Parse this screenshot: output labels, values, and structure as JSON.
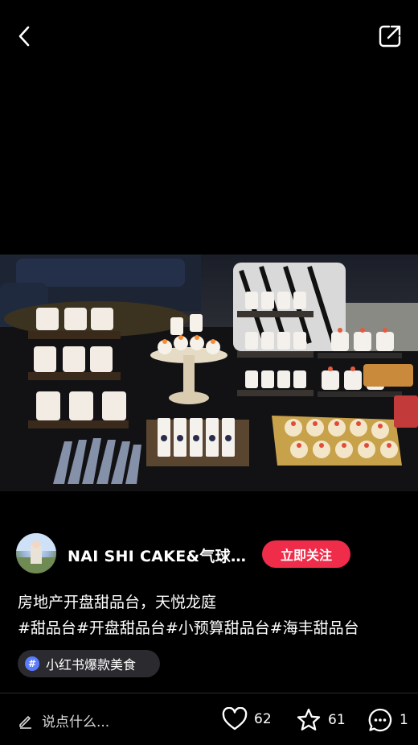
{
  "nav": {
    "back_icon": "back-arrow-icon",
    "share_icon": "share-icon"
  },
  "author": {
    "name": "NAI SHI CAKE&气球…",
    "follow_label": "立即关注"
  },
  "post": {
    "title": "房地产开盘甜品台，天悦龙庭",
    "tags": "#甜品台#开盘甜品台#小预算甜品台#海丰甜品台"
  },
  "topic": {
    "icon_text": "#",
    "label": "小红书爆款美食"
  },
  "bottom": {
    "comment_placeholder": "说点什么...",
    "likes": "62",
    "collects": "61",
    "comments": "1"
  },
  "colors": {
    "accent": "#ef2c4a",
    "topic_icon": "#5b7cff",
    "background": "#000000"
  }
}
